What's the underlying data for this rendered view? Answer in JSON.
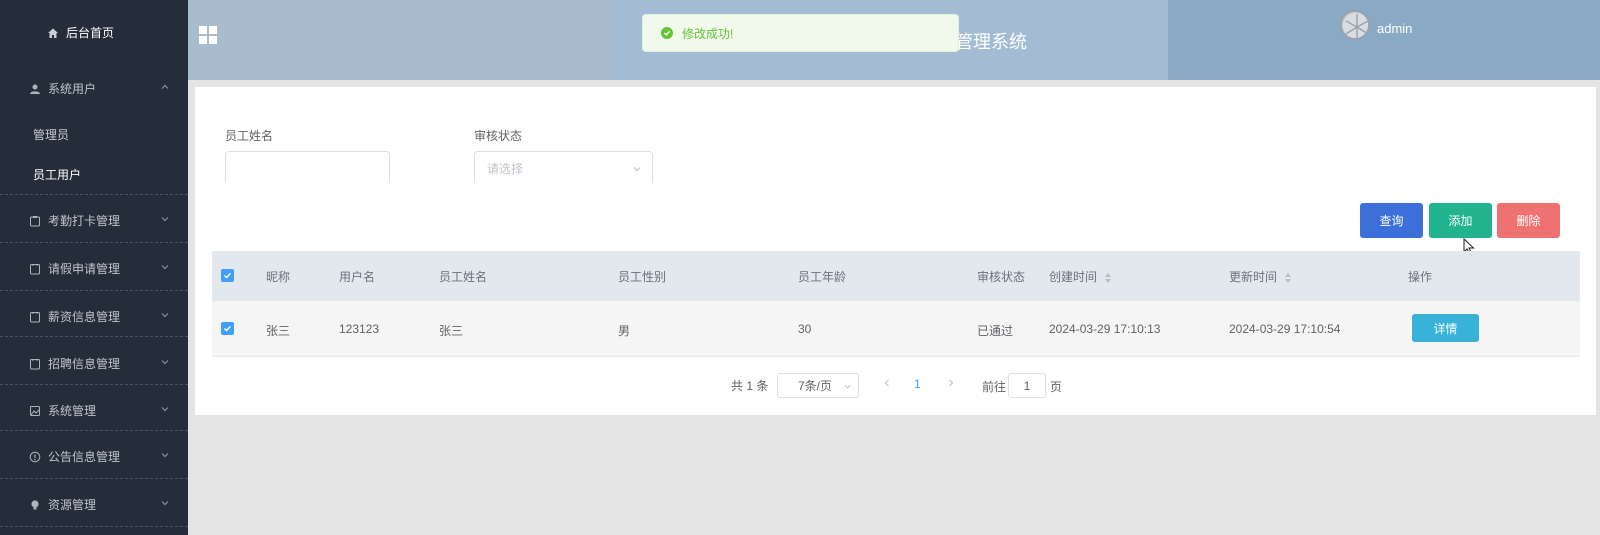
{
  "sidebar": {
    "home": "后台首页",
    "system_users": "系统用户",
    "sub_items": [
      "管理员",
      "员工用户"
    ],
    "menus": [
      "考勤打卡管理",
      "请假申请管理",
      "薪资信息管理",
      "招聘信息管理",
      "系统管理",
      "公告信息管理",
      "资源管理"
    ]
  },
  "header": {
    "title": "管理系统",
    "username": "admin"
  },
  "toast": {
    "message": "修改成功!",
    "color": "#67c23a"
  },
  "search": {
    "name_label": "员工姓名",
    "name_value": "",
    "status_label": "审核状态",
    "status_placeholder": "请选择"
  },
  "buttons": {
    "search": "查询",
    "add": "添加",
    "delete": "删除"
  },
  "table": {
    "columns": [
      "昵称",
      "用户名",
      "员工姓名",
      "员工性别",
      "员工年龄",
      "审核状态",
      "创建时间",
      "更新时间",
      "操作"
    ],
    "rows": [
      {
        "nickname": "张三",
        "username": "123123",
        "name": "张三",
        "gender": "男",
        "age": "30",
        "status": "已通过",
        "created": "2024-03-29 17:10:13",
        "updated": "2024-03-29 17:10:54",
        "action": "详情"
      }
    ]
  },
  "pagination": {
    "total": "共 1 条",
    "page_size": "7条/页",
    "current": "1",
    "goto_label": "前往",
    "goto_value": "1",
    "page_suffix": "页"
  },
  "colors": {
    "sidebar_bg": "#262d3a",
    "primary": "#3c6fd9",
    "success": "#22b38f",
    "danger": "#ef7272",
    "info": "#38b2d8"
  }
}
